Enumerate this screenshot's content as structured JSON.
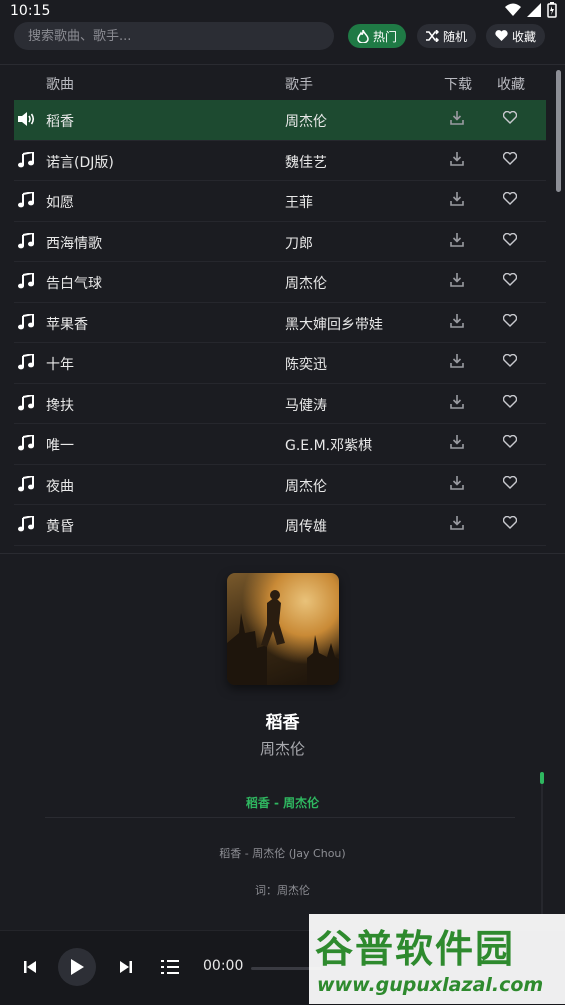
{
  "status": {
    "time": "10:15"
  },
  "search": {
    "placeholder": "搜索歌曲、歌手..."
  },
  "filters": [
    {
      "label": "热门",
      "icon": "fire-icon",
      "active": true
    },
    {
      "label": "随机",
      "icon": "shuffle-icon",
      "active": false
    },
    {
      "label": "收藏",
      "icon": "heart-icon",
      "active": false
    }
  ],
  "columns": {
    "song": "歌曲",
    "artist": "歌手",
    "download": "下载",
    "favorite": "收藏"
  },
  "songs": [
    {
      "title": "稻香",
      "artist": "周杰伦",
      "playing": true
    },
    {
      "title": "诺言(DJ版)",
      "artist": "魏佳艺"
    },
    {
      "title": "如愿",
      "artist": "王菲"
    },
    {
      "title": "西海情歌",
      "artist": "刀郎"
    },
    {
      "title": "告白气球",
      "artist": "周杰伦"
    },
    {
      "title": "苹果香",
      "artist": "黑大婶回乡带娃"
    },
    {
      "title": "十年",
      "artist": "陈奕迅"
    },
    {
      "title": "搀扶",
      "artist": "马健涛"
    },
    {
      "title": "唯一",
      "artist": "G.E.M.邓紫棋"
    },
    {
      "title": "夜曲",
      "artist": "周杰伦"
    },
    {
      "title": "黄昏",
      "artist": "周传雄"
    }
  ],
  "now_playing": {
    "title": "稻香",
    "artist": "周杰伦",
    "lyric_heading": "稻香 - 周杰伦",
    "lyrics": [
      "稻香 - 周杰伦 (Jay Chou)",
      "词：周杰伦"
    ]
  },
  "player": {
    "current_time": "00:00"
  },
  "watermark": {
    "title": "谷普软件园",
    "url": "www.gupuxlazal.com"
  },
  "colors": {
    "accent": "#2fb760",
    "active_row": "#1d4a30",
    "background": "#1b1c21"
  }
}
